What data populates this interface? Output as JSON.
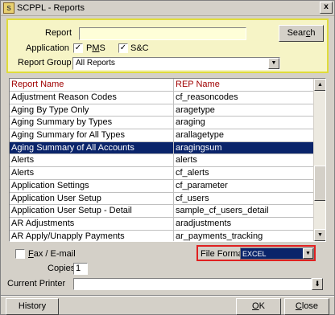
{
  "window": {
    "title": "SCPPL - Reports",
    "close_glyph": "x",
    "icon_glyph": "S",
    "icon": "app-icon"
  },
  "filter": {
    "report_label": "Report",
    "report_value": "",
    "search_label_pre": "Sear",
    "search_label_u": "c",
    "search_label_post": "h",
    "application_label": "Application",
    "pms_label_pre": "P",
    "pms_label_u": "M",
    "pms_label_post": "S",
    "pms_checked": "✓",
    "snc_label": "S&C",
    "snc_checked": "✓",
    "report_group_label": "Report Group",
    "report_group_value": "All Reports"
  },
  "grid": {
    "columns": [
      "Report Name",
      "REP Name"
    ],
    "rows": [
      [
        "Adjustment Reason Codes",
        "cf_reasoncodes"
      ],
      [
        "Aging By Type Only",
        "aragetype"
      ],
      [
        "Aging Summary by Types",
        "araging"
      ],
      [
        "Aging Summary for All Types",
        "arallagetype"
      ],
      [
        "Aging Summary of All Accounts",
        "aragingsum"
      ],
      [
        "Alerts",
        "alerts"
      ],
      [
        "Alerts",
        "cf_alerts"
      ],
      [
        "Application Settings",
        "cf_parameter"
      ],
      [
        "Application User Setup",
        "cf_users"
      ],
      [
        "Application User Setup - Detail",
        "sample_cf_users_detail"
      ],
      [
        "AR Adjustments",
        "aradjustments"
      ],
      [
        "AR Apply/Unapply Payments",
        "ar_payments_tracking"
      ]
    ],
    "selected_index": 4
  },
  "options": {
    "fax_label_u": "F",
    "fax_label_post": "ax / E-mail",
    "fax_checked": "",
    "file_format_label": "File Format",
    "file_format_value": "EXCEL",
    "copies_label": "Copies",
    "copies_value": "1",
    "current_printer_label": "Current Printer",
    "current_printer_value": "",
    "lookup_glyph": "⬇"
  },
  "footer": {
    "history_label": "History",
    "ok_label_u": "O",
    "ok_label_post": "K",
    "close_label_u": "C",
    "close_label_post": "lose"
  }
}
